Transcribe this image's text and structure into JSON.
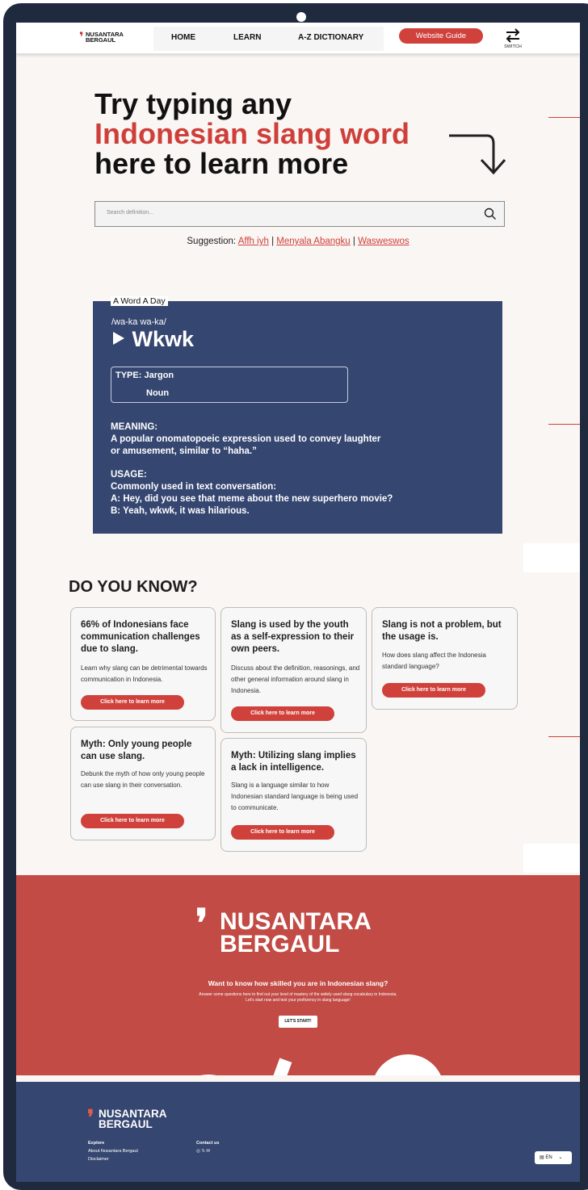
{
  "nav": {
    "logo_text": "NUSANTARA BERGAUL",
    "links": [
      "HOME",
      "LEARN",
      "A-Z DICTIONARY"
    ],
    "guide_button": "Website Guide",
    "switch_label": "SWITCH"
  },
  "hero": {
    "line1": "Try typing any",
    "line2": "Indonesian slang word",
    "line3": "here to learn more"
  },
  "search": {
    "placeholder": "Search definition..."
  },
  "suggestion": {
    "label": "Suggestion:",
    "items": [
      "Affh iyh",
      "Menyala Abangku",
      "Wasweswos"
    ],
    "separator": "|"
  },
  "word_of_day": {
    "label": "A Word A Day",
    "pronunciation": "/wa-ka wa-ka/",
    "word": "Wkwk",
    "type_label": "TYPE:",
    "type_value": "Jargon",
    "pos": "Noun",
    "meaning_label": "MEANING:",
    "meaning_line1": "A popular onomatopoeic expression used to convey laughter",
    "meaning_line2": "or amusement, similar to “haha.”",
    "usage_label": "USAGE:",
    "usage_line1": "Commonly used in text conversation:",
    "usage_line2": "A: Hey, did you see that meme about the new superhero movie?",
    "usage_line3": "B: Yeah, wkwk, it was hilarious."
  },
  "do_you_know": {
    "title": "DO YOU KNOW?",
    "cards": [
      {
        "title": "66% of Indonesians face communication challenges due to slang.",
        "text": "Learn why slang can be detrimental towards communication in Indonesia.",
        "button": "Click here to learn more"
      },
      {
        "title": "Slang is used by the youth as a self-expression to their own peers.",
        "text": "Discuss about the definition, reasonings, and other general information around slang in Indonesia.",
        "button": "Click here to learn more"
      },
      {
        "title": "Slang is not a problem, but the usage is.",
        "text": "How does slang affect the Indonesia standard language?",
        "button": "Click here to learn more"
      },
      {
        "title": "Myth: Only young people can use slang.",
        "text": "Debunk the myth of how only young people can use slang in their conversation.",
        "button": "Click here to learn more"
      },
      {
        "title": "Myth: Utilizing slang implies a lack in intelligence.",
        "text": "Slang is a language similar to how Indonesian standard language is being used to communicate.",
        "button": "Click here to learn more"
      }
    ]
  },
  "promo": {
    "logo_line1": "NUSANTARA",
    "logo_line2": "BERGAUL",
    "question": "Want to know how skilled you are in Indonesian slang?",
    "sub_line1": "Answer some questions here to find out your level of mastery of the widely used slang vocabulary in Indonesia.",
    "sub_line2": "Let's start now and test your proficiency in slang language!",
    "button": "LET'S START!"
  },
  "footer": {
    "logo_line1": "NUSANTARA",
    "logo_line2": "BERGAUL",
    "explore_heading": "Explore",
    "explore_links": [
      "About Nusantara Bergaul",
      "Disclaimer"
    ],
    "contact_heading": "Contact us",
    "language": "EN"
  },
  "colors": {
    "accent_red": "#cf3f3a",
    "navy": "#354670",
    "promo_red": "#c24b45",
    "frame": "#1f2a3f"
  }
}
